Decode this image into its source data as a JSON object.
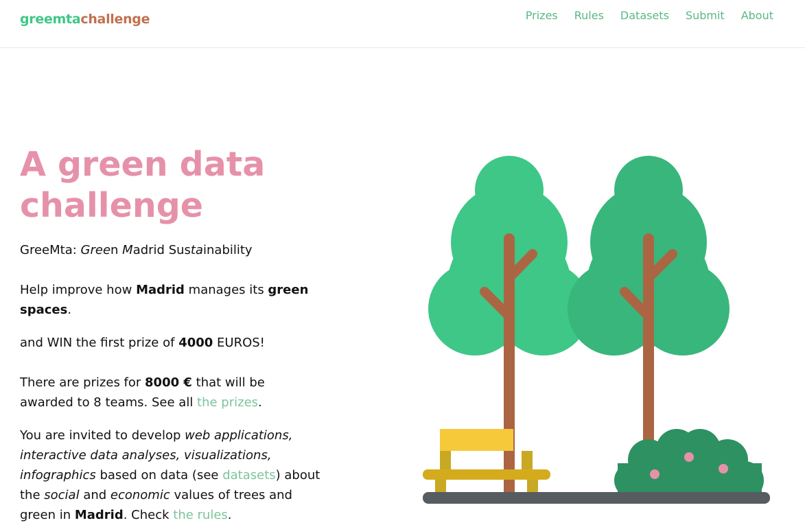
{
  "brand": {
    "part1": "greemta",
    "part2": "challenge"
  },
  "nav": {
    "items": [
      "Prizes",
      "Rules",
      "Datasets",
      "Submit",
      "About"
    ]
  },
  "hero": {
    "title": "A green data challenge"
  },
  "acronym": {
    "prefix": "GreeMta: ",
    "s1_italic": "Gree",
    "s2": "n ",
    "s3_italic": "M",
    "s4": "adrid Sus",
    "s5_italic": "ta",
    "s6": "inability"
  },
  "p1": {
    "t1": "Help improve how ",
    "b1": "Madrid",
    "t2": " manages its ",
    "b2": "green spaces",
    "t3": "."
  },
  "p2": {
    "t1": "and WIN the first prize of ",
    "b1": "4000",
    "t2": " EUROS!"
  },
  "p3": {
    "t1": "There are prizes for ",
    "b1": "8000 €",
    "t2": " that will be awarded to 8 teams. See all ",
    "link": "the prizes",
    "t3": "."
  },
  "p4": {
    "t1": "You are invited to develop ",
    "i1": "web applications, interactive data analyses, visualizations, infographics",
    "t2": " based on data (see ",
    "link1": "datasets",
    "t3": ") about the ",
    "i2": "social",
    "t4": " and ",
    "i3": "economic",
    "t5": " values of trees and green in ",
    "b1": "Madrid",
    "t6": ". Check ",
    "link2": "the rules",
    "t7": "."
  },
  "illustration": {
    "icon": "trees-bench-bush-illustration"
  },
  "colors": {
    "brand_green": "#3ec787",
    "brand_brown": "#c0714f",
    "title_pink": "#e691aa",
    "link_green": "#7cc49a"
  }
}
